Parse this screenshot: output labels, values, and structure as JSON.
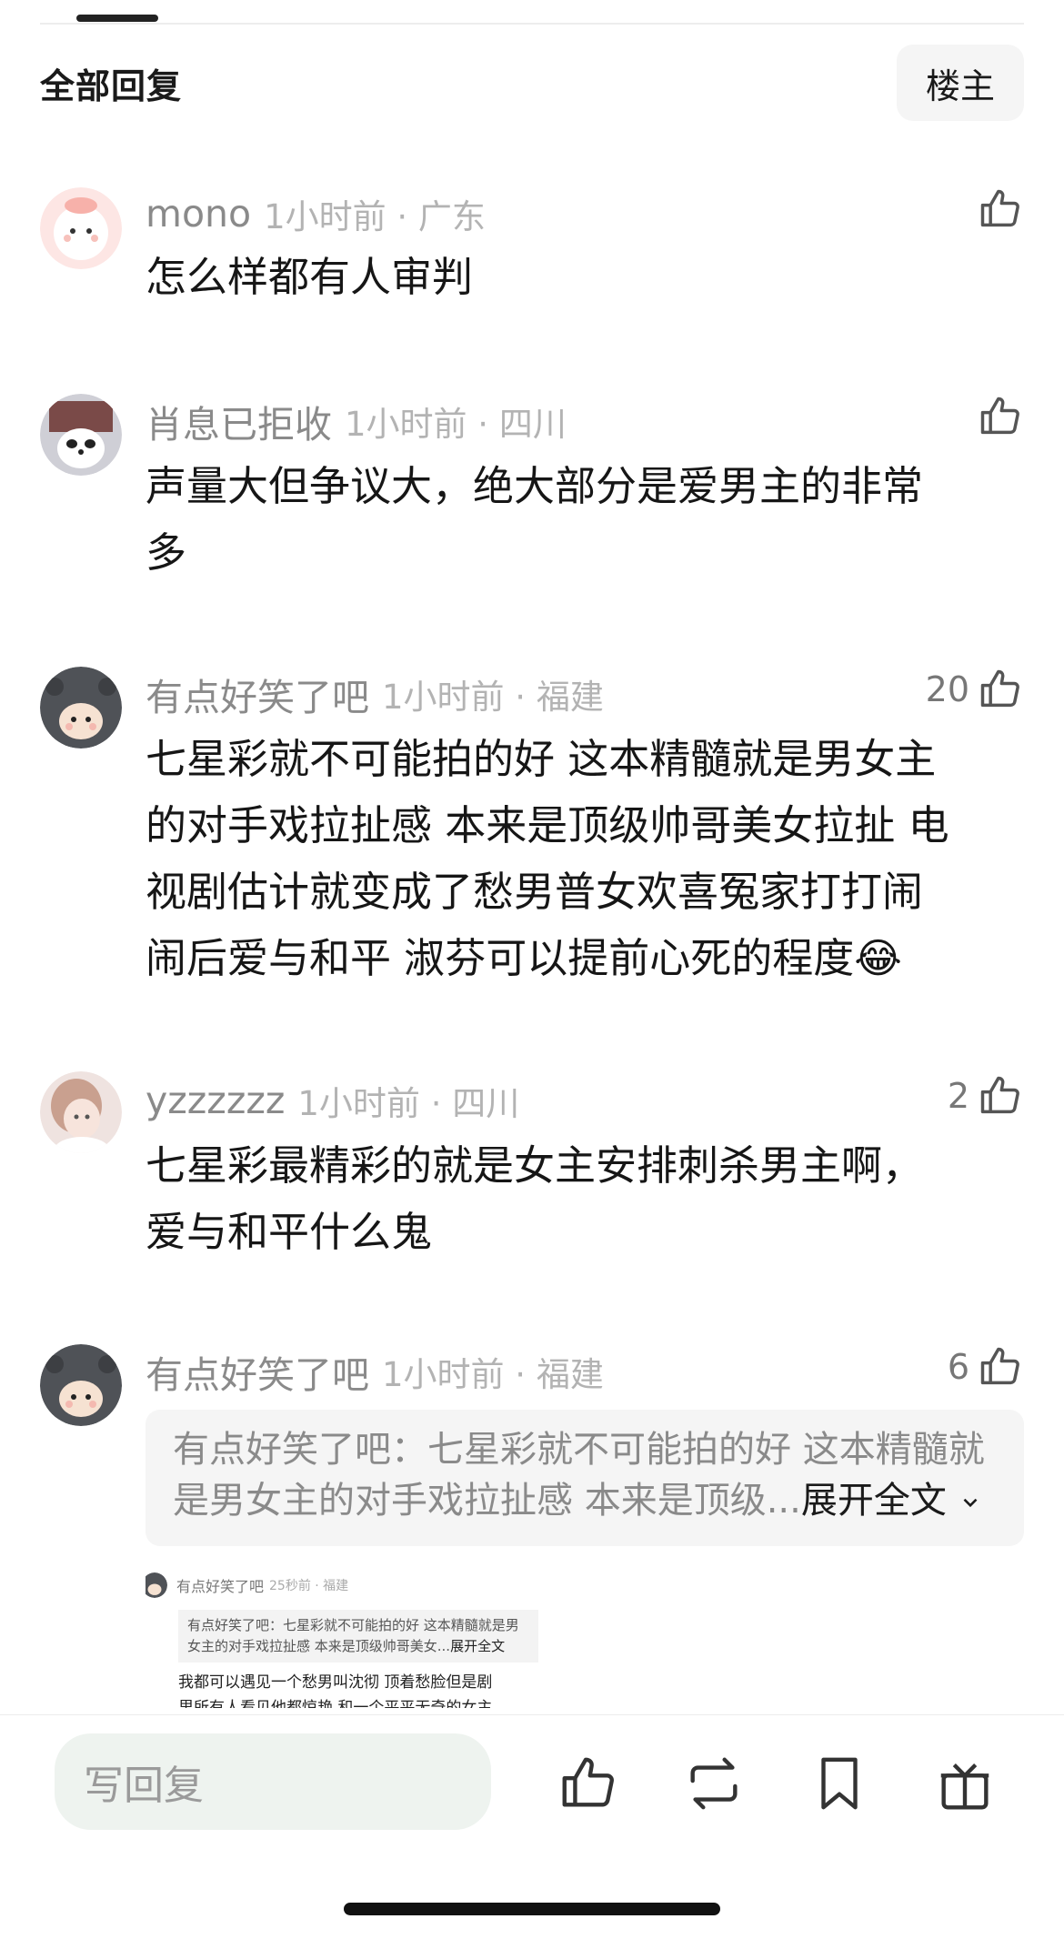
{
  "header": {
    "title": "全部回复",
    "owner_button": "楼主"
  },
  "comments": [
    {
      "author": "mono",
      "time": "1小时前 · 广东",
      "likes": "",
      "lines": [
        "怎么样都有人审判"
      ]
    },
    {
      "author": "肖息已拒收",
      "time": "1小时前 · 四川",
      "likes": "",
      "lines": [
        "声量大但争议大，绝大部分是爱男主的非常",
        "多"
      ]
    },
    {
      "author": "有点好笑了吧",
      "time": "1小时前 · 福建",
      "likes": "20",
      "lines": [
        "七星彩就不可能拍的好 这本精髓就是男女主",
        "的对手戏拉扯感 本来是顶级帅哥美女拉扯 电",
        "视剧估计就变成了愁男普女欢喜冤家打打闹",
        "闹后爱与和平 淑芬可以提前心死的程度😂"
      ]
    },
    {
      "author": "yzzzzzz",
      "time": "1小时前 · 四川",
      "likes": "2",
      "lines": [
        "七星彩最精彩的就是女主安排刺杀男主啊，",
        "爱与和平什么鬼"
      ]
    },
    {
      "author": "有点好笑了吧",
      "time": "1小时前 · 福建",
      "likes": "6",
      "quote_line1": "有点好笑了吧：七星彩就不可能拍的好 这本精髓就",
      "quote_line2": "是男女主的对手戏拉扯感 本来是顶级...",
      "expand_label": "展开全文"
    }
  ],
  "embedded_screenshot": {
    "author": "有点好笑了吧",
    "time": "25秒前 · 福建",
    "quote_line1": "有点好笑了吧：七星彩就不可能拍的好 这本精髓就是男",
    "quote_line2": "女主的对手戏拉扯感 本来是顶级帅哥美女...",
    "expand_label": "展开全文",
    "text_line1": "我都可以遇见一个愁男叫沈彻 顶着愁脸但是剧",
    "text_line2": "里所有人看见他都惊艳 和一个平平无奇的女主"
  },
  "bottom_bar": {
    "reply_placeholder": "写回复"
  },
  "icons": [
    "thumb-up-icon",
    "repost-icon",
    "bookmark-icon",
    "gift-icon",
    "chevron-down-icon"
  ],
  "colors": {
    "meta_gray": "#8a8a8a",
    "time_gray": "#b3b3b3",
    "quote_bg": "#f5f5f5",
    "reply_bg": "#eef3ef"
  }
}
